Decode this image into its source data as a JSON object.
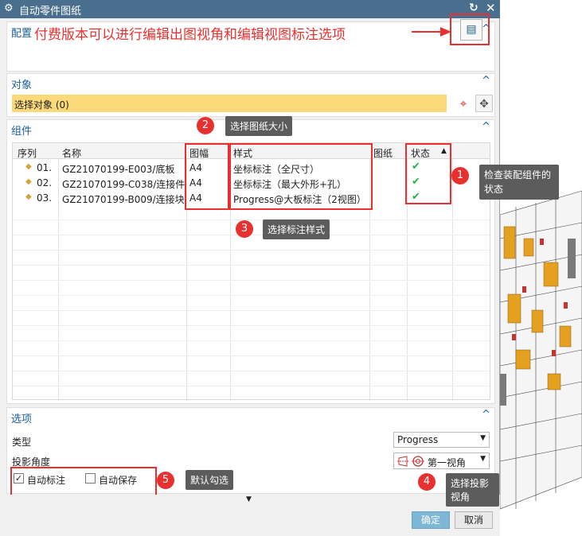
{
  "window": {
    "title": "自动零件图纸"
  },
  "config": {
    "heading": "配置",
    "note": "付费版本可以进行编辑出图视角和编辑视图标注选项"
  },
  "object": {
    "heading": "对象",
    "select_label": "选择对象 (0)"
  },
  "components": {
    "heading": "组件",
    "columns": [
      "序列",
      "名称",
      "图幅",
      "样式",
      "图纸",
      "状态"
    ],
    "rows": [
      {
        "seq": "01.",
        "name": "GZ21070199-E003/底板",
        "size": "A4",
        "style": "坐标标注（全尺寸）"
      },
      {
        "seq": "02.",
        "name": "GZ21070199-C038/连接件",
        "size": "A4",
        "style": "坐标标注（最大外形+孔）"
      },
      {
        "seq": "03.",
        "name": "GZ21070199-B009/连接块",
        "size": "A4",
        "style": "Progress@大板标注（2视图）"
      }
    ]
  },
  "callouts": {
    "c1": {
      "num": "1",
      "text": "检查装配组件的状态"
    },
    "c2": {
      "num": "2",
      "text": "选择图纸大小"
    },
    "c3": {
      "num": "3",
      "text": "选择标注样式"
    },
    "c4": {
      "num": "4",
      "text": "选择投影视角"
    },
    "c5": {
      "num": "5",
      "text": "默认勾选"
    }
  },
  "options": {
    "heading": "选项",
    "type_label": "类型",
    "type_value": "Progress",
    "projection_label": "投影角度",
    "projection_value": "第一视角",
    "auto_annotate": "自动标注",
    "auto_annotate_checked": true,
    "auto_save": "自动保存",
    "auto_save_checked": false
  },
  "buttons": {
    "ok": "确定",
    "cancel": "取消"
  },
  "colors": {
    "titlebar": "#4a6f8e",
    "accent": "#1d5f97",
    "highlight": "#e8312f",
    "selection": "#fbd97a"
  }
}
